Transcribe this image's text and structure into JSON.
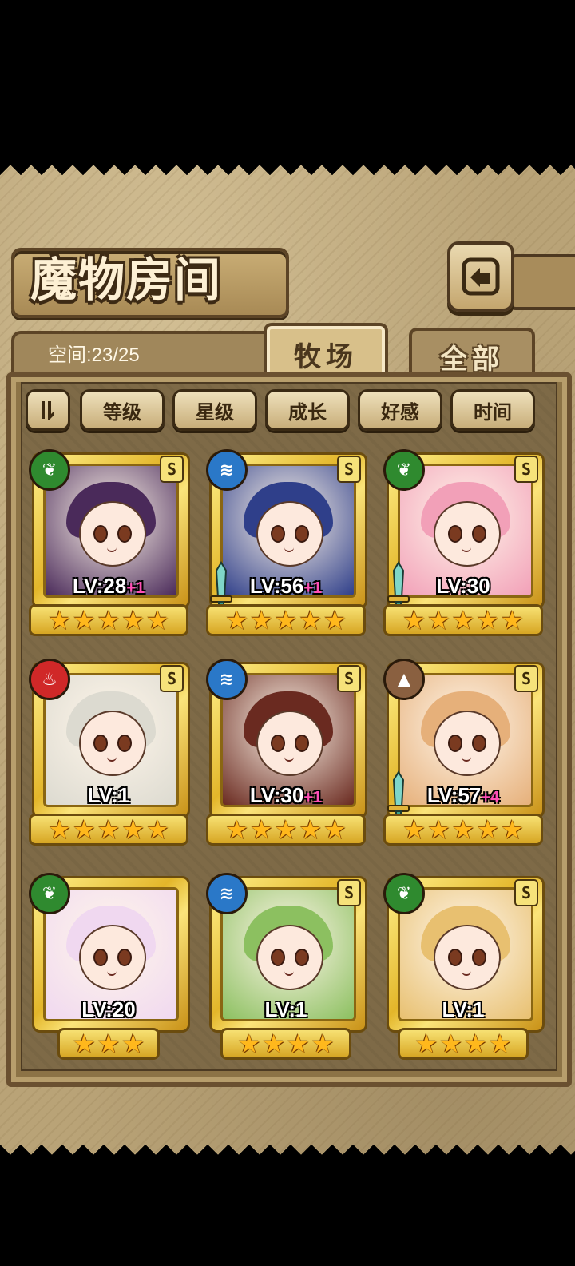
{
  "header": {
    "title": "魔物房间",
    "space_label": "空间:23/25"
  },
  "tabs": [
    {
      "label": "牧场",
      "active": true
    },
    {
      "label": "全部",
      "active": false
    }
  ],
  "sort_buttons": [
    "等级",
    "星级",
    "成长",
    "好感",
    "时间"
  ],
  "colors": {
    "wood": "#2f8a2f",
    "water": "#2a78c8",
    "fire": "#d02828",
    "earth": "#8a6040",
    "gold_frame": "#e3b62a",
    "level_plus": "#ff4fb6"
  },
  "monsters": [
    {
      "element": "wood-icon",
      "level": "LV:28",
      "plus": "+1",
      "stars": 5,
      "rarity": "S",
      "weapon": false,
      "hair": "#4a2a5a"
    },
    {
      "element": "water-icon",
      "level": "LV:56",
      "plus": "+1",
      "stars": 5,
      "rarity": "S",
      "weapon": true,
      "hair": "#2f3f8a"
    },
    {
      "element": "wood-icon",
      "level": "LV:30",
      "plus": "",
      "stars": 5,
      "rarity": "S",
      "weapon": true,
      "hair": "#f2a0b8"
    },
    {
      "element": "fire-icon",
      "level": "LV:1",
      "plus": "",
      "stars": 5,
      "rarity": "S",
      "weapon": false,
      "hair": "#dcdad0"
    },
    {
      "element": "water-icon",
      "level": "LV:30",
      "plus": "+1",
      "stars": 5,
      "rarity": "S",
      "weapon": false,
      "hair": "#6a2a20"
    },
    {
      "element": "earth-icon",
      "level": "LV:57",
      "plus": "+4",
      "stars": 5,
      "rarity": "S",
      "weapon": true,
      "hair": "#e6b07a"
    },
    {
      "element": "wood-icon",
      "level": "LV:20",
      "plus": "",
      "stars": 3,
      "rarity": "",
      "weapon": false,
      "hair": "#f0d8f0"
    },
    {
      "element": "water-icon",
      "level": "LV:1",
      "plus": "",
      "stars": 4,
      "rarity": "S",
      "weapon": false,
      "hair": "#8cc060"
    },
    {
      "element": "wood-icon",
      "level": "LV:1",
      "plus": "",
      "stars": 4,
      "rarity": "S",
      "weapon": false,
      "hair": "#e8c070"
    }
  ]
}
